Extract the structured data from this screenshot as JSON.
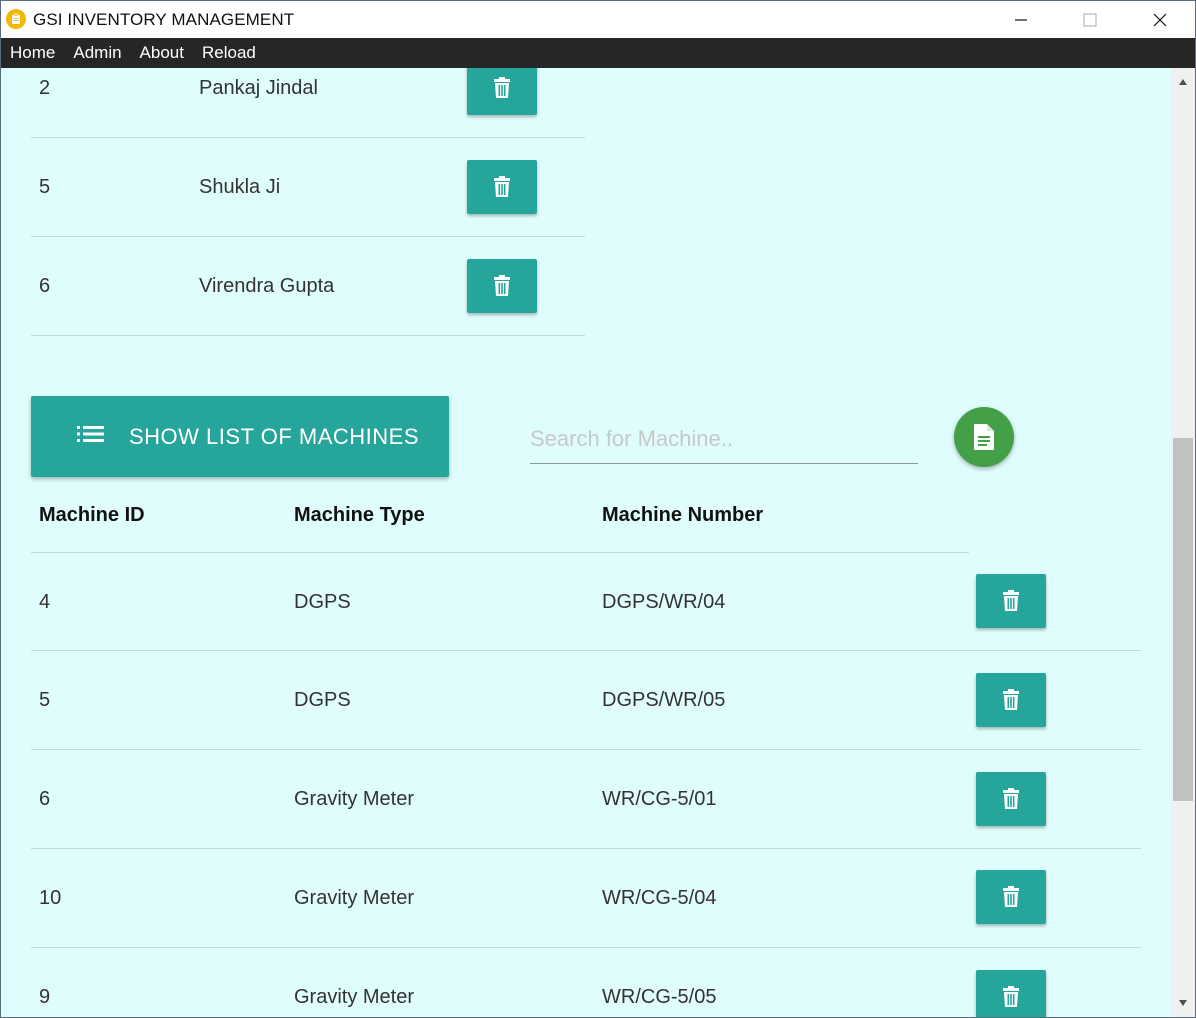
{
  "window": {
    "title": "GSI INVENTORY MANAGEMENT"
  },
  "menu": [
    "Home",
    "Admin",
    "About",
    "Reload"
  ],
  "users": [
    {
      "id": "2",
      "name": "Pankaj Jindal"
    },
    {
      "id": "5",
      "name": "Shukla Ji"
    },
    {
      "id": "6",
      "name": "Virendra Gupta"
    }
  ],
  "machines_section": {
    "show_button_label": "SHOW LIST OF MACHINES",
    "search_placeholder": "Search for Machine..",
    "search_value": "",
    "headers": [
      "Machine ID",
      "Machine Type",
      "Machine Number"
    ],
    "rows": [
      {
        "id": "4",
        "type": "DGPS",
        "number": "DGPS/WR/04"
      },
      {
        "id": "5",
        "type": "DGPS",
        "number": "DGPS/WR/05"
      },
      {
        "id": "6",
        "type": "Gravity Meter",
        "number": "WR/CG-5/01"
      },
      {
        "id": "10",
        "type": "Gravity Meter",
        "number": "WR/CG-5/04"
      },
      {
        "id": "9",
        "type": "Gravity Meter",
        "number": "WR/CG-5/05"
      }
    ]
  },
  "colors": {
    "accent": "#26a69a",
    "fab": "#43a047",
    "background": "#e0fdfd",
    "menubar": "#262626",
    "app_icon": "#f2b807"
  },
  "icons": {
    "app": "clipboard-icon",
    "delete": "trash-icon",
    "list": "list-icon",
    "report": "document-icon"
  }
}
